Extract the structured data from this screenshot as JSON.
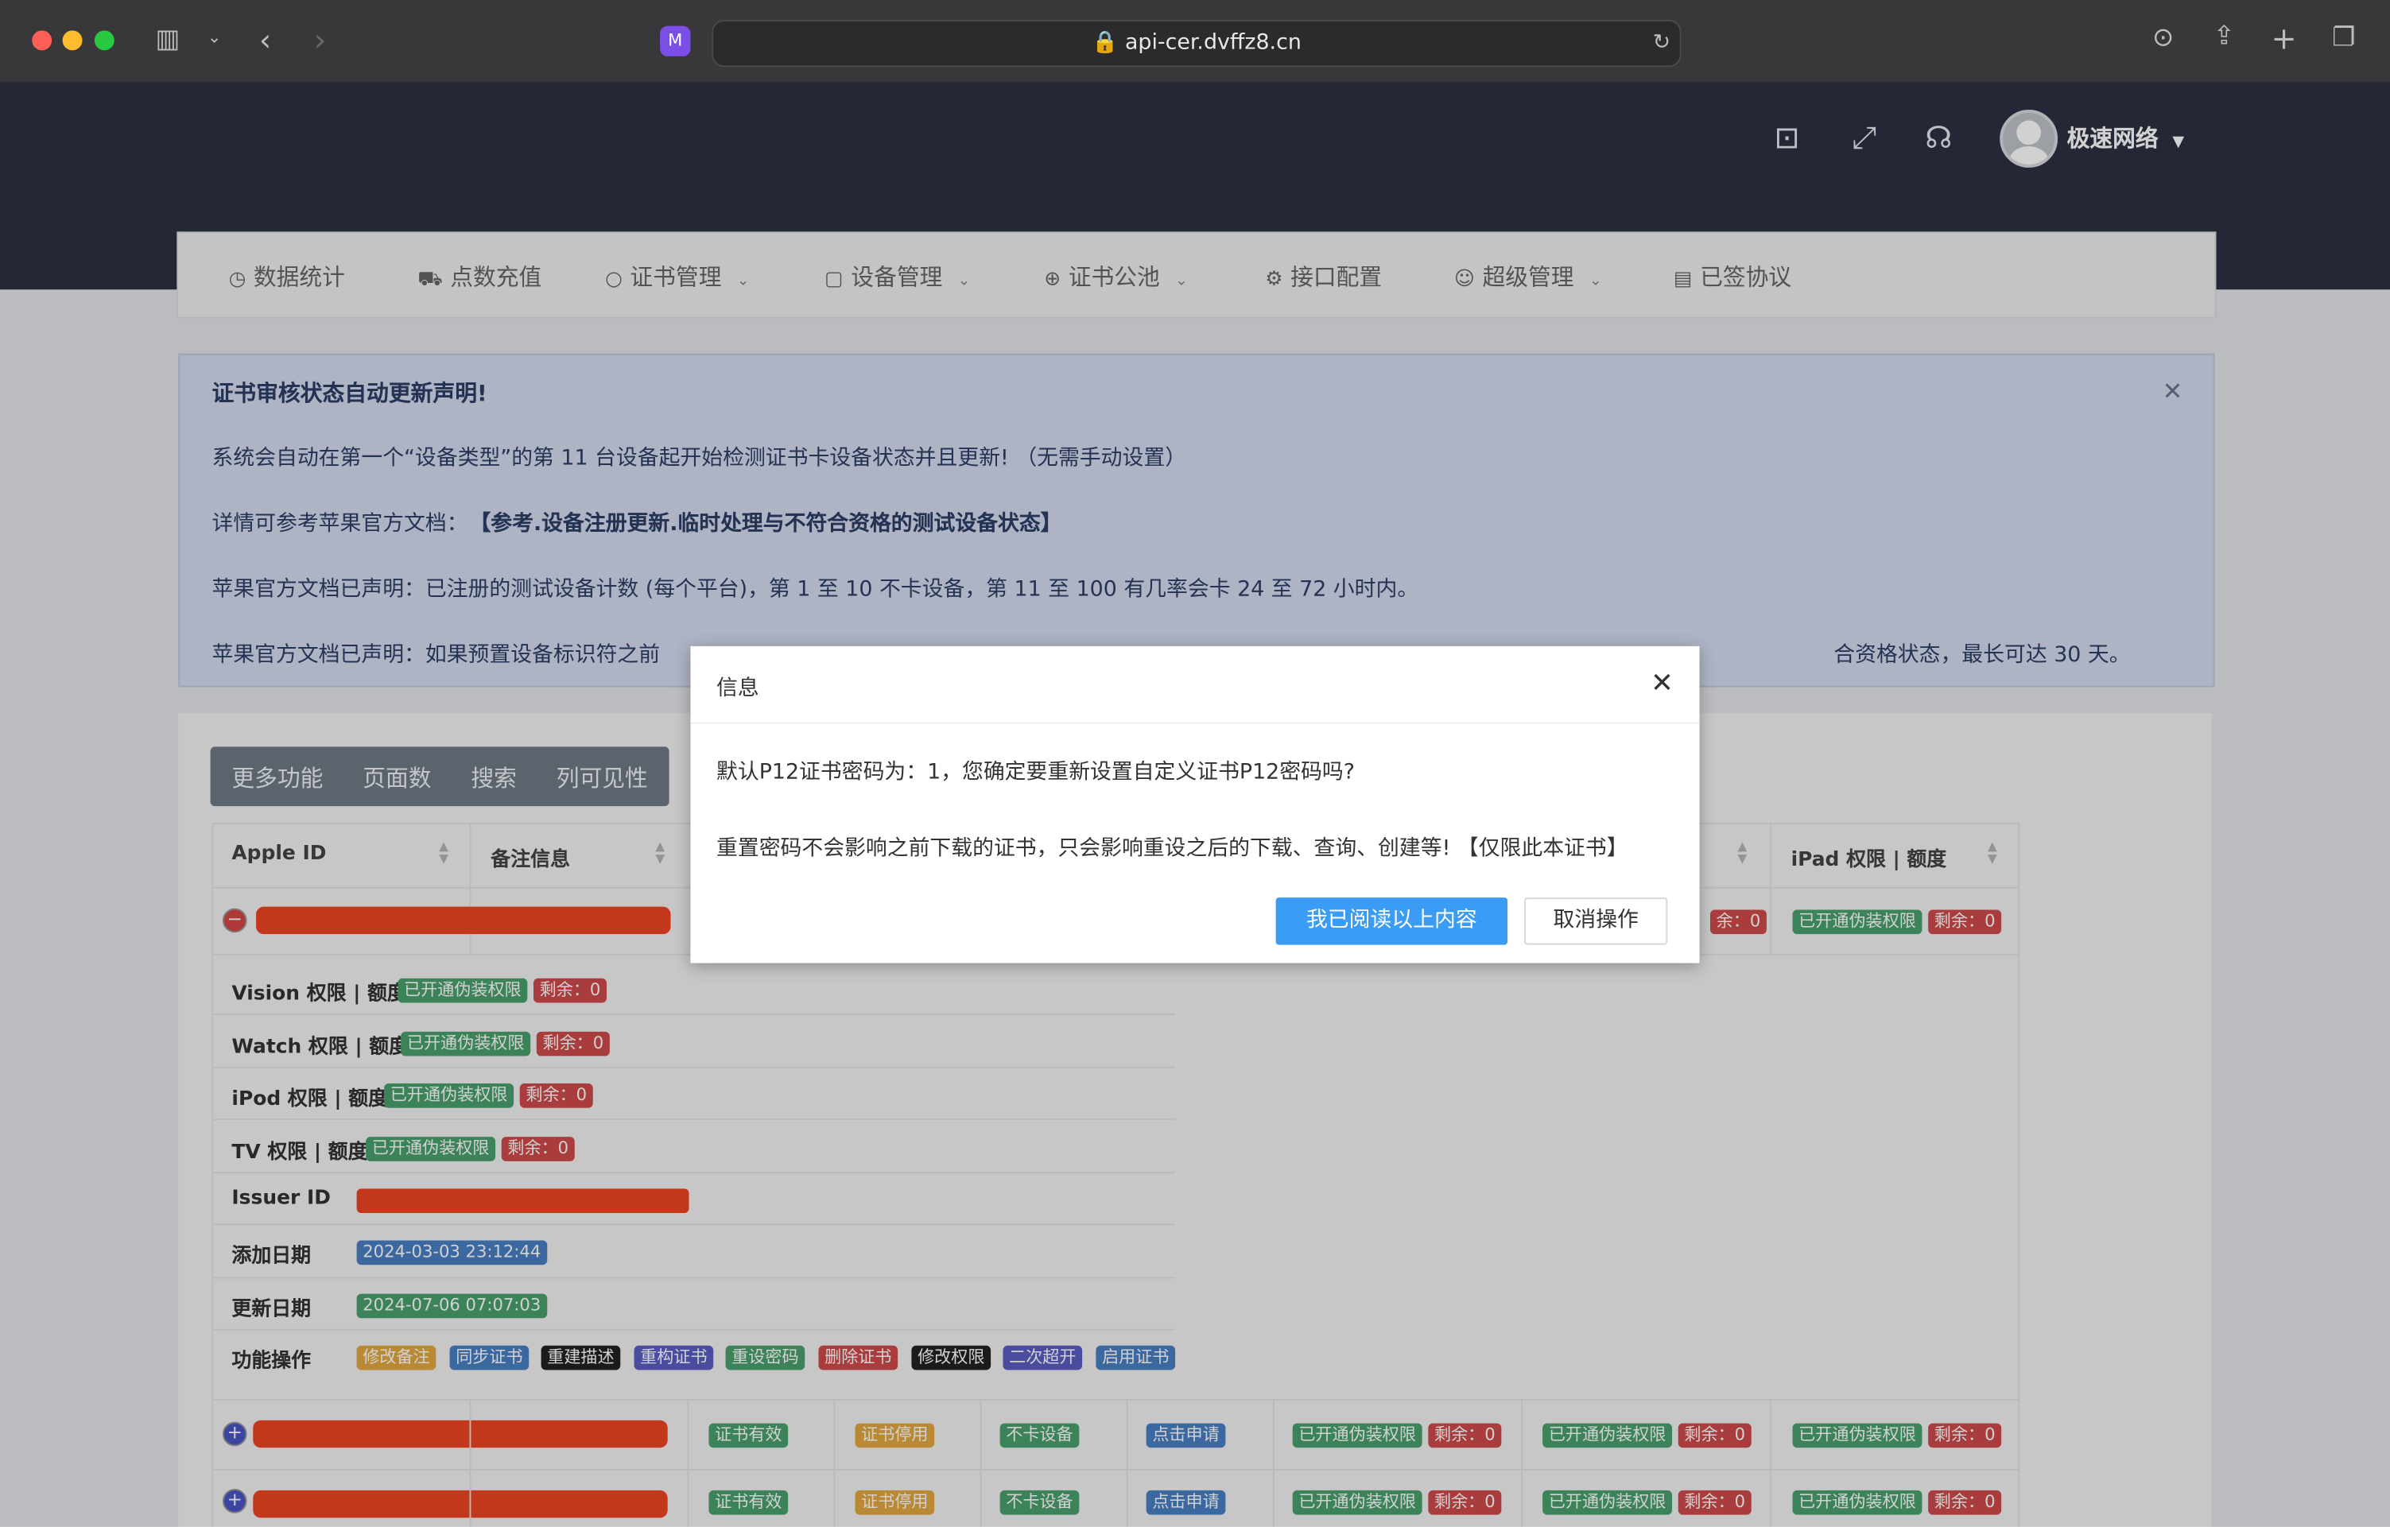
{
  "browser": {
    "url": "api-cer.dvffz8.cn",
    "ext_label": "M"
  },
  "header": {
    "username": "极速网络"
  },
  "nav": [
    {
      "label": "数据统计",
      "icon": "◷",
      "dropdown": false
    },
    {
      "label": "点数充值",
      "icon": "🛒",
      "dropdown": false
    },
    {
      "label": "证书管理",
      "icon": "○",
      "dropdown": true
    },
    {
      "label": "设备管理",
      "icon": "▢",
      "dropdown": true
    },
    {
      "label": "证书公池",
      "icon": "⊕",
      "dropdown": true
    },
    {
      "label": "接口配置",
      "icon": "⚙",
      "dropdown": false
    },
    {
      "label": "超级管理",
      "icon": "☺",
      "dropdown": true
    },
    {
      "label": "已签协议",
      "icon": "▤",
      "dropdown": false
    }
  ],
  "notice": {
    "title": "证书审核状态自动更新声明!",
    "line1": "系统会自动在第一个“设备类型”的第 11 台设备起开始检测证书卡设备状态并且更新! （无需手动设置）",
    "line2_prefix": "详情可参考苹果官方文档：",
    "line2_link": "【参考.设备注册更新.临时处理与不符合资格的测试设备状态】",
    "line3": "苹果官方文档已声明：已注册的测试设备计数 (每个平台)，第 1 至 10 不卡设备，第 11 至 100 有几率会卡 24 至 72 小时内。",
    "line4a": "苹果官方文档已声明：如果预置设备标识符之前",
    "line4b": "合资格状态，最长可达 30 天。"
  },
  "toolbar": {
    "more": "更多功能",
    "pages": "页面数",
    "search": "搜索",
    "columns": "列可见性"
  },
  "table": {
    "col_apple_id": "Apple ID",
    "col_note": "备注信息",
    "col_ipad": "iPad 权限 | 额度",
    "detail": {
      "vision": "Vision 权限 | 额度",
      "watch": "Watch 权限 | 额度",
      "ipod": "iPod 权限 | 额度",
      "tv": "TV 权限 | 额度",
      "issuer": "Issuer ID",
      "added": "添加日期",
      "added_val": "2024-03-03 23:12:44",
      "updated": "更新日期",
      "updated_val": "2024-07-06 07:07:03",
      "actions": "功能操作"
    },
    "tag_enabled": "已开通伪装权限",
    "tag_remain": "剩余：0",
    "tag_remain_short": "余：0",
    "actions": [
      "修改备注",
      "同步证书",
      "重建描述",
      "重构证书",
      "重设密码",
      "删除证书",
      "修改权限",
      "二次超开",
      "启用证书"
    ],
    "row_tags": {
      "valid": "证书有效",
      "disabled": "证书停用",
      "nocard": "不卡设备",
      "apply": "点击申请"
    }
  },
  "modal": {
    "title": "信息",
    "line1": "默认P12证书密码为：1，您确定要重新设置自定义证书P12密码吗?",
    "line2": "重置密码不会影响之前下载的证书，只会影响重设之后的下载、查询、创建等! 【仅限此本证书】",
    "confirm": "我已阅读以上内容",
    "cancel": "取消操作"
  }
}
